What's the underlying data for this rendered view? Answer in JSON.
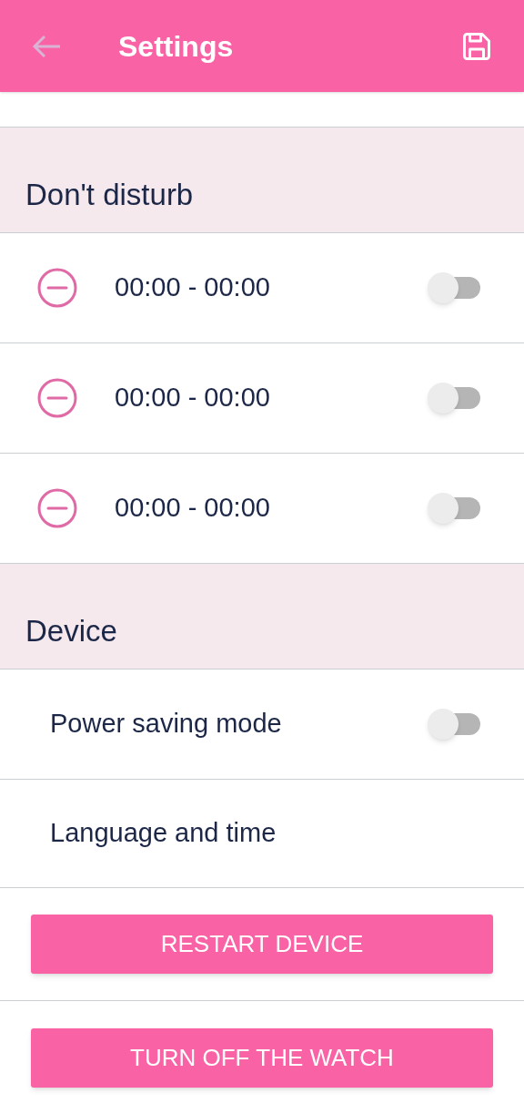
{
  "header": {
    "title": "Settings"
  },
  "sections": [
    {
      "title": "Don't disturb",
      "items": [
        {
          "kind": "period",
          "label": "00:00 - 00:00",
          "on": false
        },
        {
          "kind": "period",
          "label": "00:00 - 00:00",
          "on": false
        },
        {
          "kind": "period",
          "label": "00:00 - 00:00",
          "on": false
        }
      ]
    },
    {
      "title": "Device",
      "items": [
        {
          "kind": "toggle",
          "label": "Power saving mode",
          "on": false
        },
        {
          "kind": "link",
          "label": "Language and time"
        }
      ]
    }
  ],
  "buttons": [
    "RESTART DEVICE",
    "TURN OFF THE WATCH"
  ]
}
